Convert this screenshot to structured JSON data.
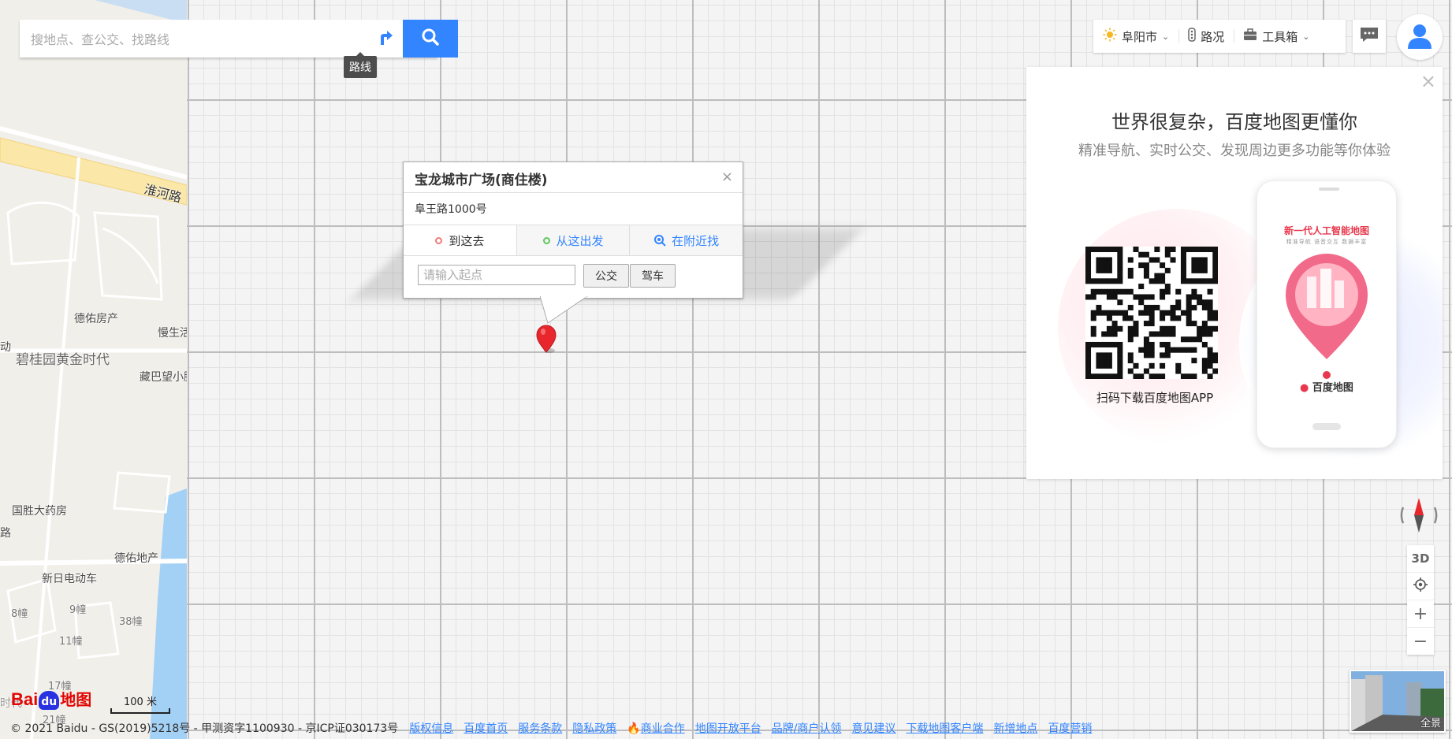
{
  "search": {
    "placeholder": "搜地点、查公交、找路线",
    "tooltip": "路线"
  },
  "toolbar": {
    "city": "阜阳市",
    "traffic": "路况",
    "toolbox": "工具箱"
  },
  "promo": {
    "title": "世界很复杂，百度地图更懂你",
    "subtitle": "精准导航、实时公交、发现周边更多功能等你体验",
    "qr_caption": "扫码下载百度地图APP",
    "phone_headline": "新一代人工智能地图",
    "phone_subline": "精准导航  语音交互  数据丰富",
    "phone_logo": "百度地图"
  },
  "popup": {
    "title": "宝龙城市广场(商住楼)",
    "address": "阜王路1000号",
    "tabs": [
      {
        "label": "到这去",
        "ring": "#f07a7a"
      },
      {
        "label": "从这出发",
        "ring": "#5cc85c"
      },
      {
        "label": "在附近找"
      }
    ],
    "input_placeholder": "请输入起点",
    "bus_btn": "公交",
    "drive_btn": "驾车"
  },
  "map_labels": {
    "road_huaihe": "淮河路",
    "deyou_realty1": "德佑房产",
    "slow_life": "慢生活",
    "biguiyuan": "碧桂园黄金时代",
    "zangba": "藏巴望小腰",
    "guosheng": "国胜大药房",
    "deyou_realty2": "德佑地产",
    "xinri": "新日电动车",
    "b8": "8幢",
    "b9": "9幢",
    "b38": "38幢",
    "b11": "11幢",
    "b17": "17幢",
    "b21": "21幢",
    "edge_dong": "动",
    "edge_lu": "路",
    "edge_shi": "时代"
  },
  "controls": {
    "three_d": "3D",
    "panorama": "全景"
  },
  "scale": "100 米",
  "logo": {
    "bai": "Bai",
    "du": "du",
    "ditu": "地图"
  },
  "footer": {
    "copyright": "© 2021 Baidu - GS(2019)5218号 - 甲测资字1100930 - 京ICP证030173号",
    "links": [
      "版权信息",
      "百度首页",
      "服务条款",
      "隐私政策",
      "商业合作",
      "地图开放平台",
      "品牌/商户认领",
      "意见建议",
      "下载地图客户端",
      "新增地点",
      "百度营销"
    ]
  },
  "colors": {
    "accent": "#3385ff",
    "marker": "#e8262b",
    "logo_red": "#e10602",
    "logo_blue": "#2932e1"
  }
}
